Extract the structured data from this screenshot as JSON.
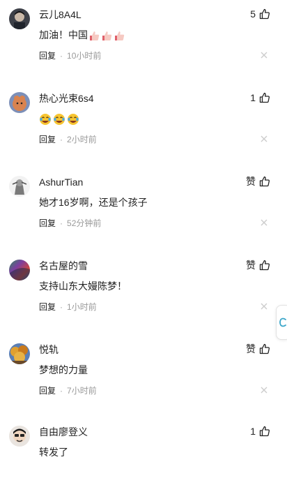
{
  "comments": [
    {
      "user": "云儿8A4L",
      "likes": "5",
      "text": "加油！中国",
      "reply": "回复",
      "sep": "·",
      "time": "10小时前",
      "emoji": "thumbs-up"
    },
    {
      "user": "热心光束6s4",
      "likes": "1",
      "text": "",
      "reply": "回复",
      "sep": "·",
      "time": "2小时前",
      "emoji": "laughing-crying"
    },
    {
      "user": "AshurTian",
      "likes": "赞",
      "text": "她才16岁啊，还是个孩子",
      "reply": "回复",
      "sep": "·",
      "time": "52分钟前"
    },
    {
      "user": "名古屋的雪",
      "likes": "赞",
      "text": "支持山东大嫚陈梦！",
      "reply": "回复",
      "sep": "·",
      "time": "1小时前"
    },
    {
      "user": "悦轨",
      "likes": "赞",
      "text": "梦想的力量",
      "reply": "回复",
      "sep": "·",
      "time": "7小时前"
    },
    {
      "user": "自由廖登义",
      "likes": "1",
      "text": "转发了",
      "reply": "",
      "sep": "",
      "time": ""
    }
  ],
  "colors": {
    "text": "#222222",
    "muted": "#999999",
    "close": "#cccccc"
  },
  "icons": {
    "like": "thumbs-up-outline-icon",
    "close": "close-icon",
    "side": "chat-bubble-icon"
  }
}
